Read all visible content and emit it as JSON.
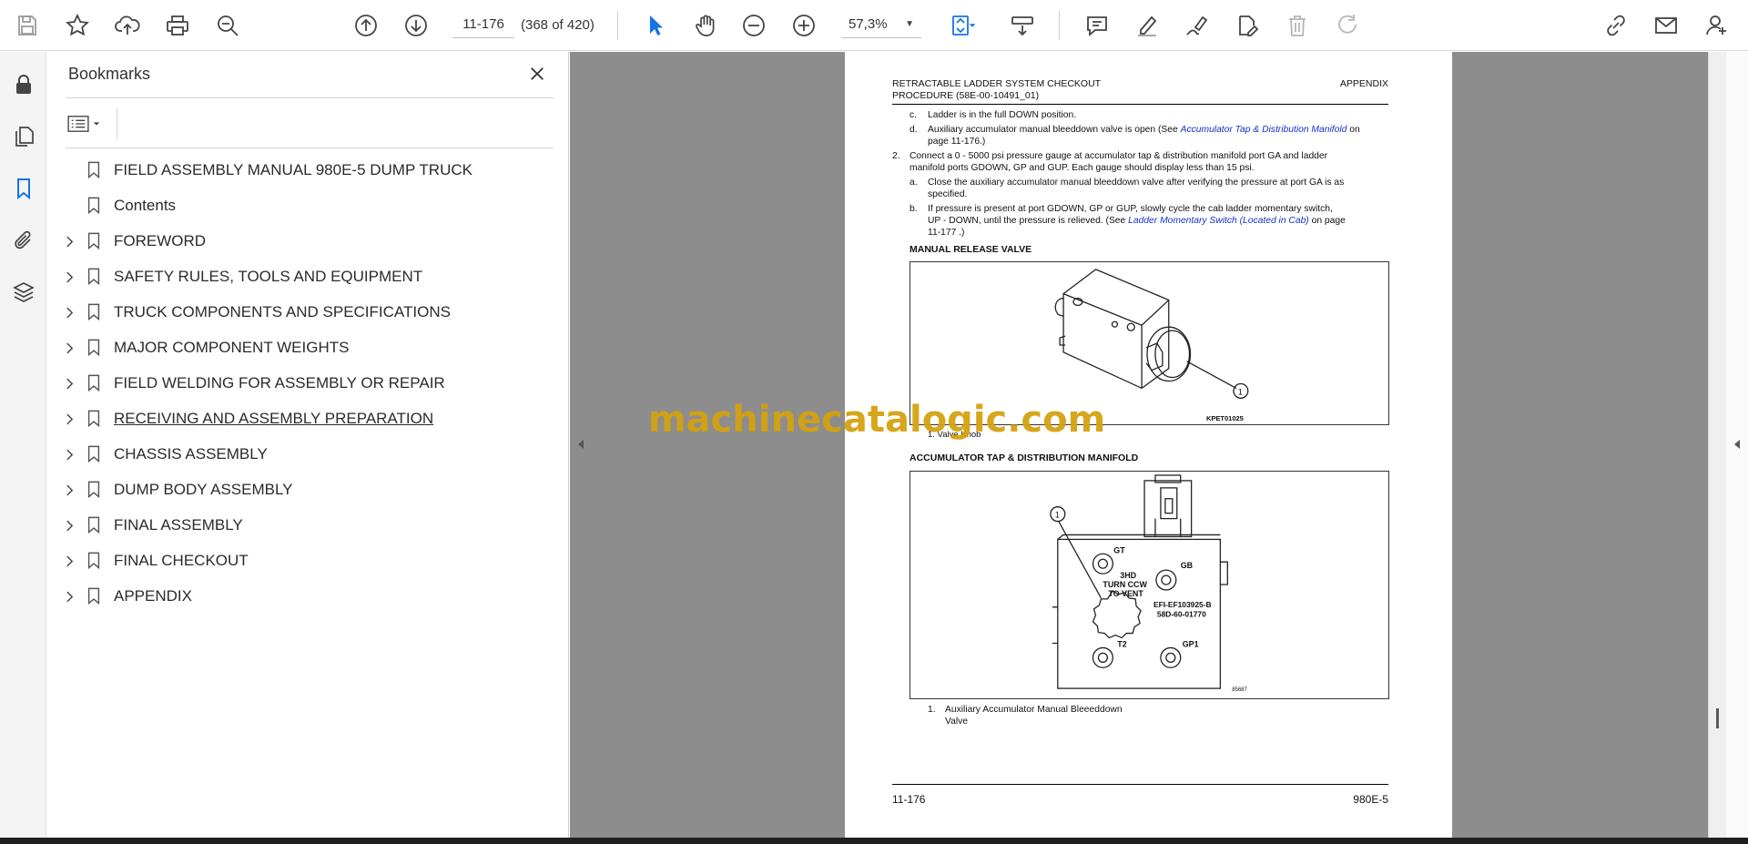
{
  "toolbar": {
    "page_value": "11-176",
    "page_count": "(368 of 420)",
    "zoom_value": "57,3%"
  },
  "panel": {
    "title": "Bookmarks"
  },
  "bookmarks": [
    {
      "label": "FIELD ASSEMBLY MANUAL 980E-5  DUMP TRUCK",
      "expandable": false
    },
    {
      "label": "Contents",
      "expandable": false
    },
    {
      "label": "FOREWORD",
      "expandable": true
    },
    {
      "label": "SAFETY RULES, TOOLS AND EQUIPMENT",
      "expandable": true
    },
    {
      "label": "TRUCK COMPONENTS AND SPECIFICATIONS",
      "expandable": true
    },
    {
      "label": "MAJOR COMPONENT WEIGHTS",
      "expandable": true
    },
    {
      "label": "FIELD WELDING FOR ASSEMBLY OR REPAIR",
      "expandable": true
    },
    {
      "label": "RECEIVING AND ASSEMBLY PREPARATION",
      "expandable": true
    },
    {
      "label": "CHASSIS ASSEMBLY",
      "expandable": true
    },
    {
      "label": "DUMP BODY ASSEMBLY",
      "expandable": true
    },
    {
      "label": "FINAL ASSEMBLY",
      "expandable": true
    },
    {
      "label": "FINAL CHECKOUT",
      "expandable": true
    },
    {
      "label": "APPENDIX",
      "expandable": true
    }
  ],
  "doc": {
    "header_left_1": "RETRACTABLE LADDER SYSTEM CHECKOUT",
    "header_left_2": "PROCEDURE (58E-00-10491_01)",
    "header_right": "APPENDIX",
    "c_marker": "c.",
    "c_text": "Ladder is in the full DOWN position.",
    "d_marker": "d.",
    "d_text_1": "Auxiliary accumulator manual bleeddown valve is open (See ",
    "d_link": "Accumulator Tap & Distribution Manifold",
    "d_text_2": " on",
    "d_text_3": "page 11-176.)",
    "step2_marker": "2.",
    "step2_text_1": "Connect a 0 - 5000 psi pressure gauge at accumulator tap & distribution manifold port GA and ladder",
    "step2_text_2": "manifold ports GDOWN, GP and GUP. Each gauge should display less than 15 psi.",
    "a_marker": "a.",
    "a_text_1": "Close the auxiliary accumulator manual bleeddown valve after verifying the pressure at port GA is as",
    "a_text_2": "specified.",
    "b_marker": "b.",
    "b_text_1": "If pressure is present at port GDOWN, GP or GUP, slowly cycle the cab ladder momentary switch,",
    "b_text_2": "UP - DOWN, until the pressure is relieved. (See ",
    "b_link": "Ladder Momentary Switch (Located in Cab)",
    "b_text_3": " on page",
    "b_text_4": "11-177 .)",
    "fig1_title": "MANUAL RELEASE VALVE",
    "fig1_callout": "1",
    "fig1_code": "KPET01025",
    "fig1_caption": "1.  Valve Knob",
    "fig2_title": "ACCUMULATOR TAP & DISTRIBUTION MANIFOLD",
    "fig2_callout": "1",
    "fig2_port_gt": "GT",
    "fig2_port_gb": "GB",
    "fig2_port_t2": "T2",
    "fig2_port_gp1": "GP1",
    "fig2_text_1": "3HD",
    "fig2_text_2": "TURN  CCW",
    "fig2_text_3": "TO  VENT",
    "fig2_text_4": "EFI-EF103925-B",
    "fig2_text_5": "58D-60-01770",
    "fig2_code": "85687",
    "fig2_caption_marker": "1.",
    "fig2_caption_1": "Auxiliary Accumulator Manual Bleeeddown",
    "fig2_caption_2": "Valve",
    "footer_left": "11-176",
    "footer_right": "980E-5"
  },
  "watermark": "machinecatalogic.com",
  "colors": {
    "accent_blue": "#1473e6",
    "link_blue": "#1530c8",
    "doc_bg": "#8d8d8d",
    "watermark": "#d4a210"
  },
  "icons": [
    "save-icon",
    "star-icon",
    "upload-icon",
    "print-icon",
    "zoom-search-icon",
    "previous-page-icon",
    "next-page-icon",
    "select-arrow-icon",
    "hand-icon",
    "zoom-out-icon",
    "zoom-in-icon",
    "fit-page-icon",
    "scroll-mode-icon",
    "comment-icon",
    "highlight-icon",
    "sign-icon",
    "edit-pdf-icon",
    "delete-icon",
    "redo-icon",
    "share-link-icon",
    "email-icon",
    "account-icon",
    "lock-icon",
    "pages-icon",
    "bookmark-icon",
    "attachment-icon",
    "layers-icon"
  ]
}
